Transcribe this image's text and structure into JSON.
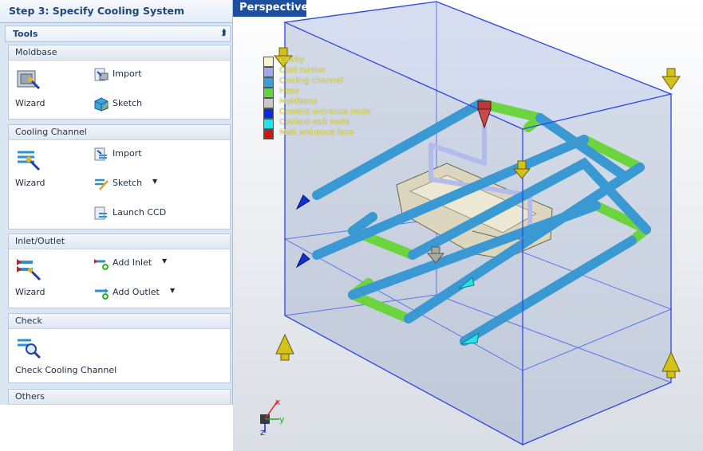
{
  "step_title": "Step 3: Specify Cooling System",
  "tools_header": "Tools",
  "groups": {
    "moldbase": {
      "title": "Moldbase",
      "wizard": "Wizard",
      "import": "Import",
      "sketch": "Sketch"
    },
    "cooling": {
      "title": "Cooling Channel",
      "wizard": "Wizard",
      "import": "Import",
      "sketch": "Sketch",
      "launch": "Launch CCD"
    },
    "inlet": {
      "title": "Inlet/Outlet",
      "wizard": "Wizard",
      "add_inlet": "Add Inlet",
      "add_outlet": "Add Outlet"
    },
    "check": {
      "title": "Check",
      "check_channel": "Check Cooling Channel"
    },
    "others": {
      "title": "Others"
    }
  },
  "viewport": {
    "tab": "Perspective",
    "legend": [
      {
        "label": "Cavity",
        "color": "#f8f4cf"
      },
      {
        "label": "Cold runner",
        "color": "#9fa8e8"
      },
      {
        "label": "Cooling channel",
        "color": "#3e9cd6"
      },
      {
        "label": "Hose",
        "color": "#5fd73c"
      },
      {
        "label": "Moldbase",
        "color": "#c8c8c8"
      },
      {
        "label": "Coolant entrance node",
        "color": "#0c2bdc"
      },
      {
        "label": "Coolant exit node",
        "color": "#1fe3ea"
      },
      {
        "label": "Melt entrance face",
        "color": "#c41a1a"
      }
    ],
    "axes": {
      "x": "x",
      "y": "y",
      "z": "z"
    }
  },
  "colors": {
    "accent": "#1d4ea0",
    "channel": "#3e9cd6",
    "hose": "#6cd23f",
    "box": "#2b47e0"
  }
}
